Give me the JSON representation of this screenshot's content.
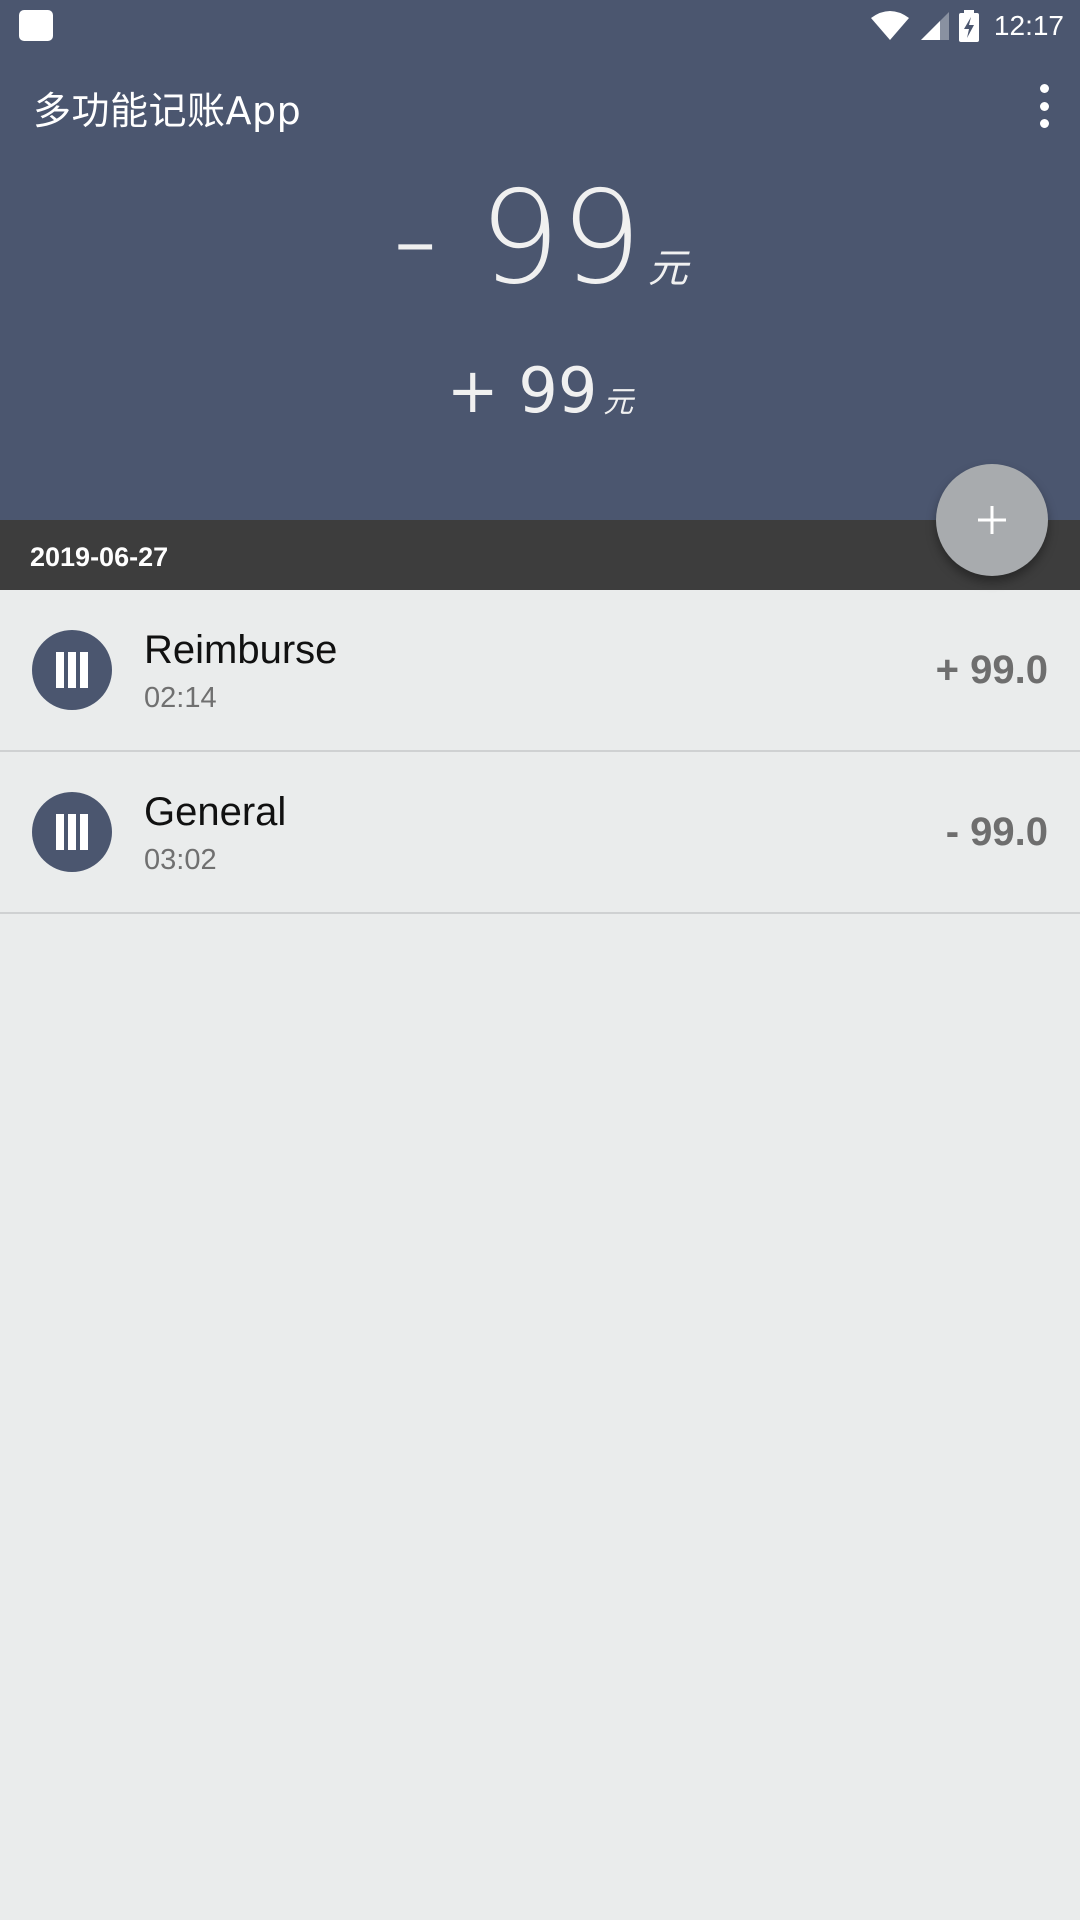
{
  "status_bar": {
    "time": "12:17",
    "icons": [
      "notification-icon",
      "wifi-icon",
      "signal-icon",
      "battery-charging-icon"
    ]
  },
  "app_bar": {
    "title": "多功能记账App",
    "menu_icon": "more-vert-icon"
  },
  "summary": {
    "expense": "- 99",
    "expense_unit": "元",
    "income": "+ 99",
    "income_unit": "元"
  },
  "fab": {
    "icon": "plus-icon"
  },
  "date_header": "2019-06-27",
  "records": [
    {
      "title": "Reimburse",
      "time": "02:14",
      "amount": "+ 99.0",
      "icon": "category-icon"
    },
    {
      "title": "General",
      "time": "03:02",
      "amount": "- 99.0",
      "icon": "category-icon"
    }
  ],
  "colors": {
    "header": "#4b566f",
    "date_bar": "#3d3d3d",
    "background": "#eaecec",
    "fab": "#a8abae"
  }
}
